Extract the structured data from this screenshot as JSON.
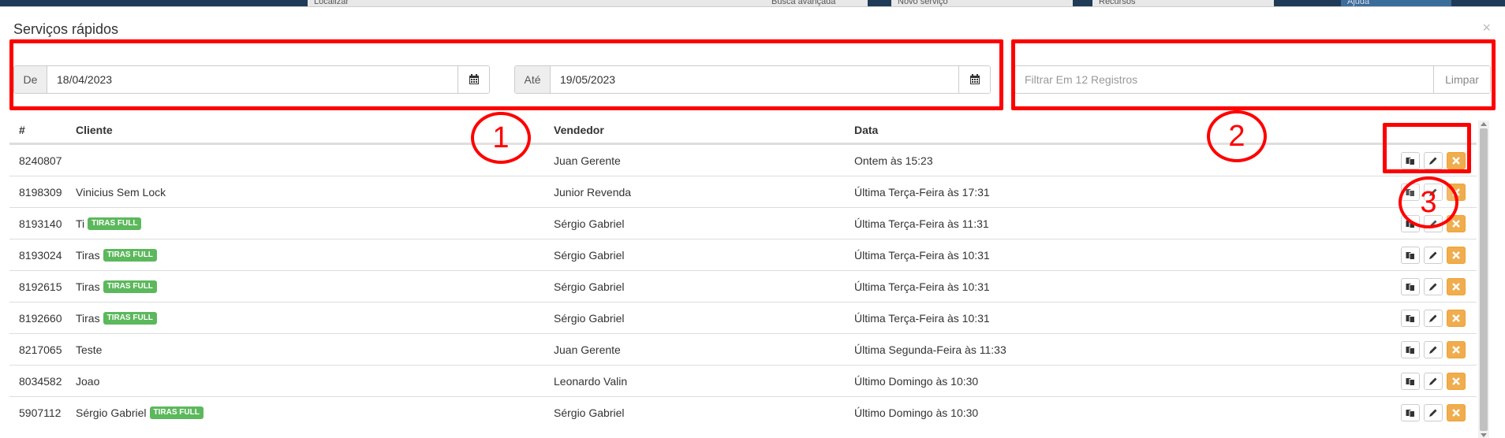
{
  "app_bar": {
    "search_placeholder": "Localizar",
    "advanced_search": "Busca avançada",
    "new_service": "Novo serviço",
    "resources": "Recursos",
    "help": "Ajuda"
  },
  "modal": {
    "title": "Serviços rápidos",
    "close": "×"
  },
  "filters": {
    "from_label": "De",
    "from_value": "18/04/2023",
    "to_label": "Até",
    "to_value": "19/05/2023",
    "search_placeholder": "Filtrar Em 12 Registros",
    "clear_label": "Limpar"
  },
  "table": {
    "headers": {
      "id": "#",
      "client": "Cliente",
      "seller": "Vendedor",
      "date": "Data"
    },
    "rows": [
      {
        "id": "8240807",
        "client": "",
        "badge": "",
        "seller": "Juan Gerente",
        "date": "Ontem às 15:23"
      },
      {
        "id": "8198309",
        "client": "Vinicius Sem Lock",
        "badge": "",
        "seller": "Junior Revenda",
        "date": "Última Terça-Feira às 17:31"
      },
      {
        "id": "8193140",
        "client": "Ti",
        "badge": "TIRAS FULL",
        "seller": "Sérgio Gabriel",
        "date": "Última Terça-Feira às 11:31"
      },
      {
        "id": "8193024",
        "client": "Tiras",
        "badge": "TIRAS FULL",
        "seller": "Sérgio Gabriel",
        "date": "Última Terça-Feira às 10:31"
      },
      {
        "id": "8192615",
        "client": "Tiras",
        "badge": "TIRAS FULL",
        "seller": "Sérgio Gabriel",
        "date": "Última Terça-Feira às 10:31"
      },
      {
        "id": "8192660",
        "client": "Tiras",
        "badge": "TIRAS FULL",
        "seller": "Sérgio Gabriel",
        "date": "Última Terça-Feira às 10:31"
      },
      {
        "id": "8217065",
        "client": "Teste",
        "badge": "",
        "seller": "Juan Gerente",
        "date": "Última Segunda-Feira às 11:33"
      },
      {
        "id": "8034582",
        "client": "Joao",
        "badge": "",
        "seller": "Leonardo Valin",
        "date": "Último Domingo às 10:30"
      },
      {
        "id": "5907112",
        "client": "Sérgio Gabriel",
        "badge": "TIRAS FULL",
        "seller": "Sérgio Gabriel",
        "date": "Último Domingo às 10:30"
      }
    ]
  },
  "annotations": {
    "one": "1",
    "two": "2",
    "three": "3"
  },
  "icons": {
    "calendar": "calendar-icon",
    "copy": "copy-icon",
    "edit": "pencil-icon",
    "delete": "close-icon"
  },
  "colors": {
    "badge": "#5cb85c",
    "delete_button": "#f0ad4e",
    "annotation": "#ff0000"
  }
}
